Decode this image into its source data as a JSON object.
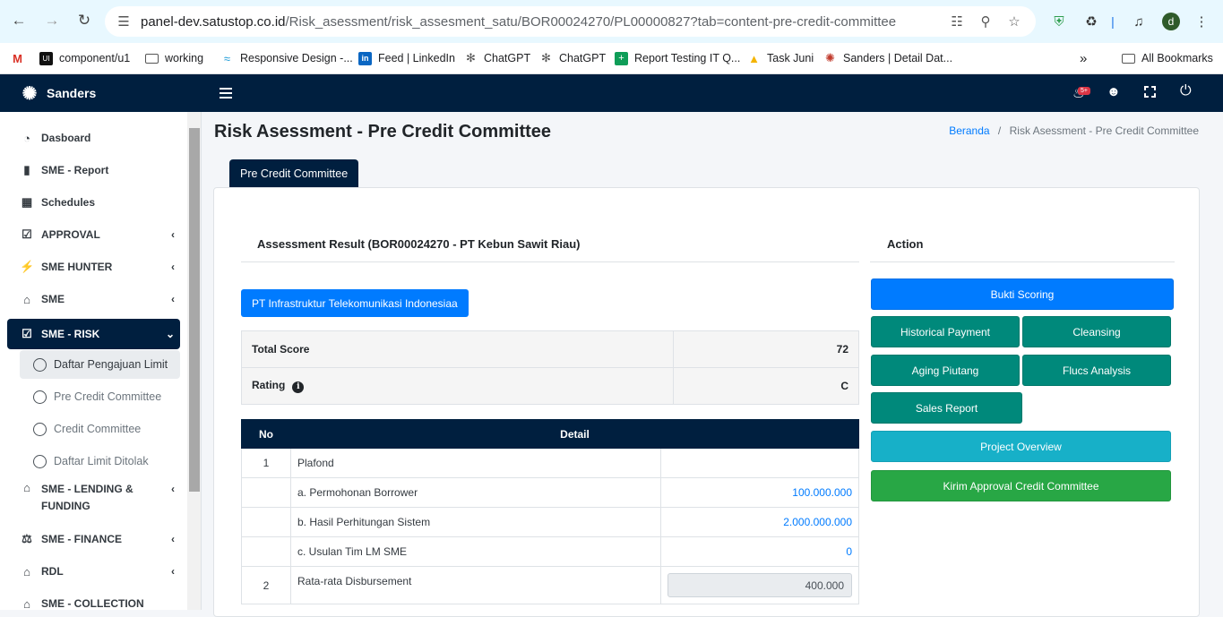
{
  "browser": {
    "url_host": "panel-dev.satustop.co.id",
    "url_path": "/Risk_asessment/risk_assesment_satu/BOR00024270/PL00000827?tab=content-pre-credit-committee",
    "profile_initial": "d",
    "bookmarks": [
      {
        "label": "",
        "icon": "gmail-icon"
      },
      {
        "label": "component/u1",
        "icon": "ui-icon"
      },
      {
        "label": "working",
        "icon": "folder-icon"
      },
      {
        "label": "Responsive Design -...",
        "icon": "wave-icon"
      },
      {
        "label": "Feed | LinkedIn",
        "icon": "linkedin-icon"
      },
      {
        "label": "ChatGPT",
        "icon": "chatgpt-icon"
      },
      {
        "label": "ChatGPT",
        "icon": "chatgpt-icon"
      },
      {
        "label": "Report Testing IT Q...",
        "icon": "sheets-icon"
      },
      {
        "label": "Task Juni",
        "icon": "drive-icon"
      },
      {
        "label": "Sanders | Detail Dat...",
        "icon": "sanders-icon"
      }
    ],
    "all_bookmarks": "All Bookmarks",
    "more_symbol": "»"
  },
  "app": {
    "brand": "Sanders",
    "notification_badge": "5+",
    "colors": {
      "navy": "#001f3f",
      "primary": "#007bff",
      "teal": "#00897b",
      "info": "#17a2b8",
      "success": "#28a745"
    }
  },
  "sidebar": {
    "items": [
      {
        "label": "Dasboard",
        "icon": "dashboard-icon"
      },
      {
        "label": "SME - Report",
        "icon": "file-icon"
      },
      {
        "label": "Schedules",
        "icon": "calendar-icon"
      },
      {
        "label": "APPROVAL",
        "icon": "check-square-icon"
      },
      {
        "label": "SME HUNTER",
        "icon": "bolt-icon"
      },
      {
        "label": "SME",
        "icon": "bank-icon"
      },
      {
        "label": "SME - RISK",
        "icon": "clipboard-check-icon"
      },
      {
        "label": "SME - LENDING &",
        "label2": "FUNDING",
        "icon": "bank-icon"
      },
      {
        "label": "SME - FINANCE",
        "icon": "balance-icon"
      },
      {
        "label": "RDL",
        "icon": "bank-icon"
      },
      {
        "label": "SME - COLLECTION",
        "icon": "bank-icon"
      }
    ],
    "sub_items": [
      {
        "label": "Daftar Pengajuan Limit"
      },
      {
        "label": "Pre Credit Committee"
      },
      {
        "label": "Credit Committee"
      },
      {
        "label": "Daftar Limit Ditolak"
      }
    ]
  },
  "page": {
    "title": "Risk Asessment - Pre Credit Committee",
    "breadcrumb_home": "Beranda",
    "breadcrumb_sep": "/",
    "breadcrumb_current": "Risk Asessment - Pre Credit Committee",
    "tab": "Pre Credit Committee"
  },
  "result": {
    "title": "Assessment Result (BOR00024270 - PT Kebun Sawit Riau)",
    "company_button": "PT Infrastruktur Telekomunikasi Indonesiaa",
    "total_score_label": "Total Score",
    "total_score": "72",
    "rating_label": "Rating",
    "rating": "C",
    "detail_headers": {
      "no": "No",
      "detail": "Detail"
    },
    "detail_rows": [
      {
        "no": "1",
        "label": "Plafond",
        "value": ""
      },
      {
        "no": "",
        "label": "a. Permohonan Borrower",
        "value": "100.000.000"
      },
      {
        "no": "",
        "label": "b. Hasil Perhitungan Sistem",
        "value": "2.000.000.000"
      },
      {
        "no": "",
        "label": "c. Usulan Tim LM SME",
        "value": "0"
      },
      {
        "no": "2",
        "label": "Rata-rata Disbursement",
        "value": "400.000"
      }
    ]
  },
  "action": {
    "title": "Action",
    "buttons": {
      "bukti_scoring": "Bukti Scoring",
      "historical_payment": "Historical Payment",
      "cleansing": "Cleansing",
      "aging_piutang": "Aging Piutang",
      "flucs_analysis": "Flucs Analysis",
      "sales_report": "Sales Report",
      "project_overview": "Project Overview",
      "kirim_approval": "Kirim Approval Credit Committee"
    }
  }
}
